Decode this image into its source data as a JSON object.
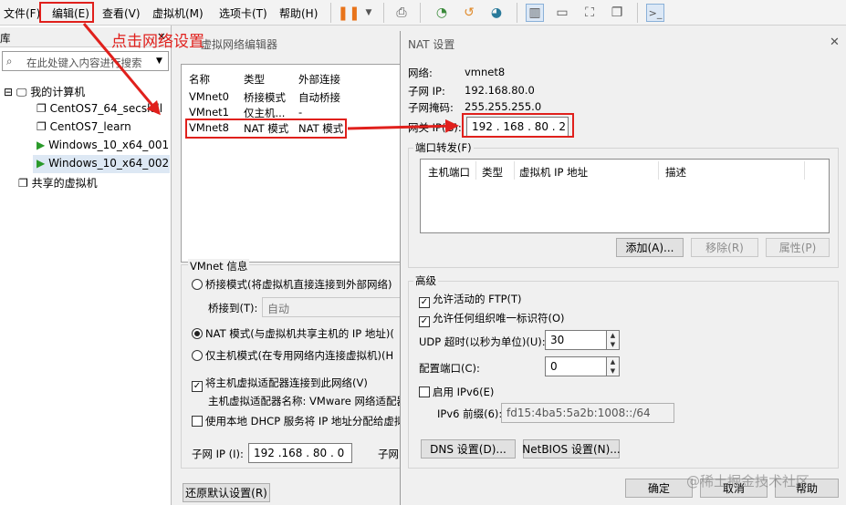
{
  "menu": {
    "file": "文件(F)",
    "edit": "编辑(E)",
    "view": "查看(V)",
    "vm": "虚拟机(M)",
    "tabs": "选项卡(T)",
    "help": "帮助(H)"
  },
  "annotation": {
    "text": "点击网络设置",
    "color": "#e0201c"
  },
  "library": {
    "title": "库",
    "search_placeholder": "在此处键入内容进行搜索",
    "my_computer": "我的计算机",
    "vms": [
      "CentOS7_64_secskill",
      "CentOS7_learn",
      "Windows_10_x64_001",
      "Windows_10_x64_002"
    ],
    "shared": "共享的虚拟机"
  },
  "vnet_editor": {
    "title": "虚拟网络编辑器",
    "columns": [
      "名称",
      "类型",
      "外部连接"
    ],
    "rows": [
      [
        "VMnet0",
        "桥接模式",
        "自动桥接"
      ],
      [
        "VMnet1",
        "仅主机...",
        "-"
      ],
      [
        "VMnet8",
        "NAT 模式",
        "NAT 模式"
      ]
    ],
    "info_title": "VMnet 信息",
    "bridge_label": "桥接模式(将虚拟机直接连接到外部网络)",
    "bridge_to_label": "桥接到(T):",
    "bridge_to_value": "自动",
    "nat_label": "NAT 模式(与虚拟机共享主机的 IP 地址)(",
    "host_only_label": "仅主机模式(在专用网络内连接虚拟机)(H",
    "connect_adapter_label": "将主机虚拟适配器连接到此网络(V)",
    "adapter_name_label": "主机虚拟适配器名称: VMware 网络适配器",
    "dhcp_label": "使用本地 DHCP 服务将 IP 地址分配给虚拟",
    "subnet_ip_label": "子网 IP (I):",
    "subnet_ip_value": "192 .168 . 80  .  0",
    "subnet_mask_label": "子网",
    "restore_button": "还原默认设置(R)"
  },
  "nat": {
    "title": "NAT 设置",
    "network_label": "网络:",
    "network_value": "vmnet8",
    "subnet_ip_label": "子网 IP:",
    "subnet_ip_value": "192.168.80.0",
    "subnet_mask_label": "子网掩码:",
    "subnet_mask_value": "255.255.255.0",
    "gateway_label": "网关 IP(G):",
    "gateway_value": "192 . 168 . 80  .  2",
    "port_forward_title": "端口转发(F)",
    "pf_columns": [
      "主机端口",
      "类型",
      "虚拟机 IP 地址",
      "描述"
    ],
    "add_button": "添加(A)...",
    "remove_button": "移除(R)",
    "props_button": "属性(P)",
    "advanced_title": "高级",
    "allow_ftp": "允许活动的 FTP(T)",
    "allow_org": "允许任何组织唯一标识符(O)",
    "udp_label": "UDP 超时(以秒为单位)(U):",
    "udp_value": "30",
    "config_port_label": "配置端口(C):",
    "config_port_value": "0",
    "ipv6_label": "启用 IPv6(E)",
    "ipv6_prefix_label": "IPv6 前缀(6):",
    "ipv6_prefix_value": "fd15:4ba5:5a2b:1008::/64",
    "dns_button": "DNS 设置(D)...",
    "netbios_button": "NetBIOS 设置(N)...",
    "ok_button": "确定",
    "cancel_button": "取消",
    "help_button": "帮助"
  },
  "watermark": "@稀土掘金技术社区"
}
